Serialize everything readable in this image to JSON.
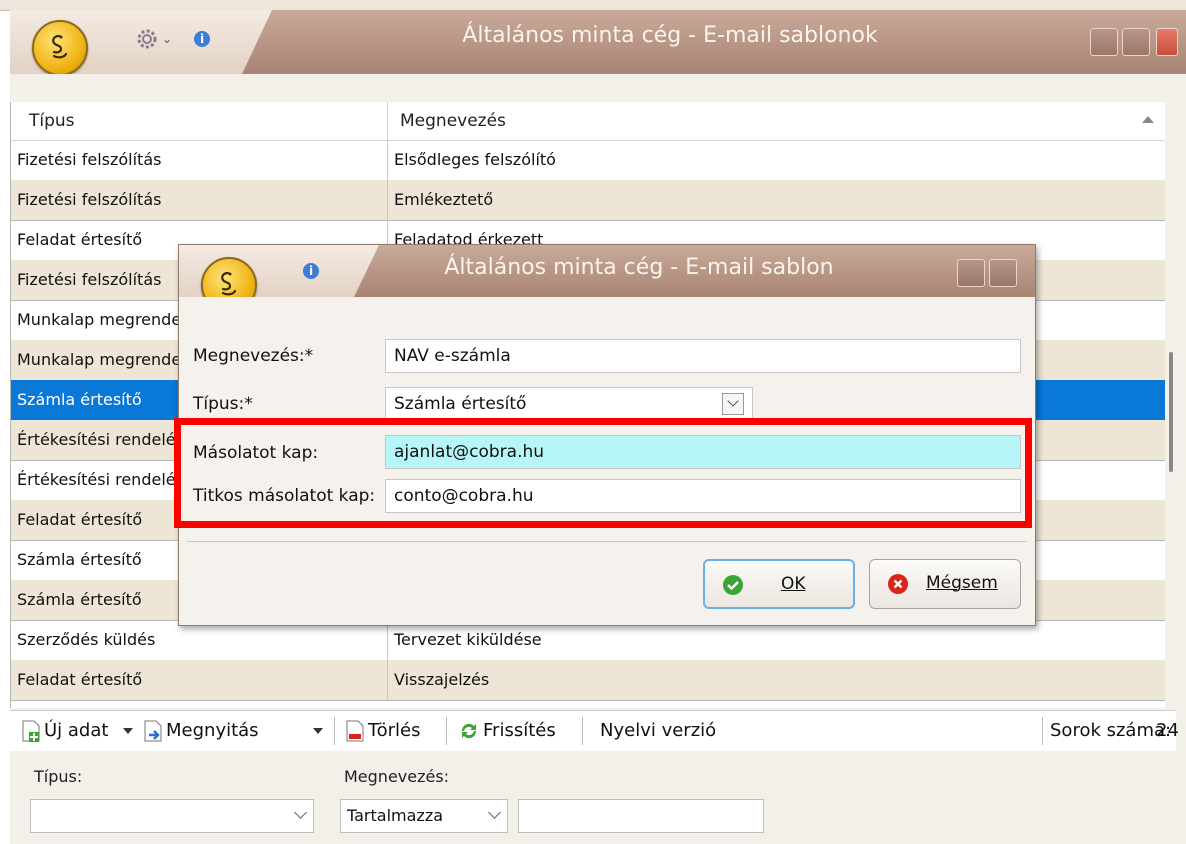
{
  "main_window": {
    "title": "Általános minta cég - E-mail sablonok"
  },
  "grid": {
    "columns": [
      "Típus",
      "Megnevezés"
    ],
    "rows": [
      {
        "type": "Fizetési felszólítás",
        "name": "Elsődleges felszólító"
      },
      {
        "type": "Fizetési felszólítás",
        "name": "Emlékeztető"
      },
      {
        "type": "Feladat értesítő",
        "name": "Feladatod érkezett"
      },
      {
        "type": "Fizetési felszólítás",
        "name": ""
      },
      {
        "type": "Munkalap megrendelés",
        "name": ""
      },
      {
        "type": "Munkalap megrendelés",
        "name": ""
      },
      {
        "type": "Számla értesítő",
        "name": ""
      },
      {
        "type": "Értékesítési rendelés",
        "name": ""
      },
      {
        "type": "Értékesítési rendelés",
        "name": ""
      },
      {
        "type": "Feladat értesítő",
        "name": ""
      },
      {
        "type": "Számla értesítő",
        "name": ""
      },
      {
        "type": "Számla értesítő",
        "name": ""
      },
      {
        "type": "Szerződés küldés",
        "name": "Tervezet kiküldése"
      },
      {
        "type": "Feladat értesítő",
        "name": "Visszajelzés"
      }
    ]
  },
  "toolbar": {
    "new_label": "Új adat",
    "open_label": "Megnyitás",
    "delete_label": "Törlés",
    "refresh_label": "Frissítés",
    "language_label": "Nyelvi verzió",
    "row_count_label": "Sorok száma:",
    "row_count_value": "24"
  },
  "filter": {
    "type_label": "Típus:",
    "type_value": "",
    "name_label": "Megnevezés:",
    "name_mode": "Tartalmazza",
    "name_value": ""
  },
  "dialog": {
    "title": "Általános minta cég - E-mail sablon",
    "name_label": "Megnevezés:*",
    "name_value": "NAV e-számla",
    "type_label": "Típus:*",
    "type_value": "Számla értesítő",
    "cc_label": "Másolatot kap:",
    "cc_value": "ajanlat@cobra.hu",
    "bcc_label": "Titkos másolatot kap:",
    "bcc_value": "conto@cobra.hu",
    "ok_label": "OK",
    "cancel_label": "Mégsem"
  },
  "colors": {
    "selection": "#0a78d7",
    "alt_row": "#ede6d6",
    "highlight_box": "#ff0000",
    "cc_field": "#b6f6f8"
  },
  "icons": [
    "cobra-logo-icon",
    "gear-icon",
    "info-icon",
    "minimize-icon",
    "maximize-icon",
    "close-icon",
    "new-doc-icon",
    "open-doc-icon",
    "delete-doc-icon",
    "refresh-icon",
    "ok-check-icon",
    "cancel-x-icon"
  ]
}
